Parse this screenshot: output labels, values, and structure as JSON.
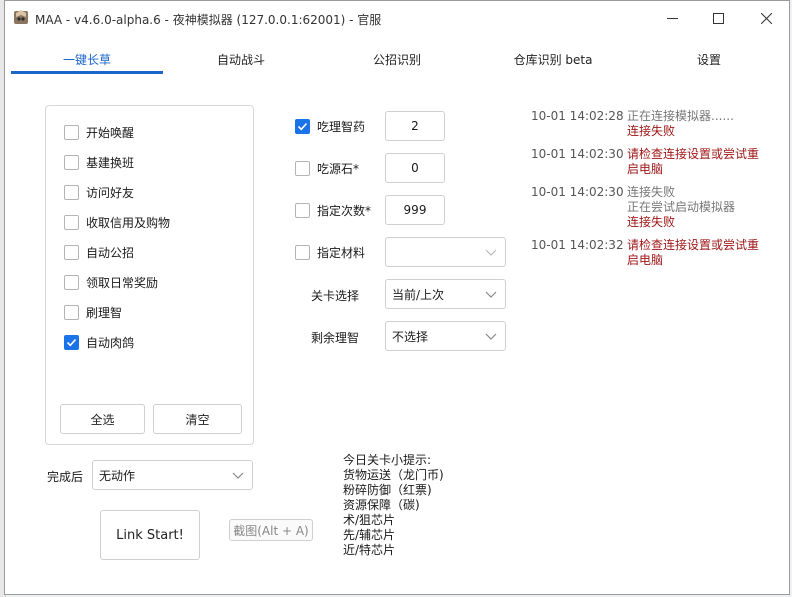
{
  "window": {
    "title": "MAA - v4.6.0-alpha.6 - 夜神模拟器 (127.0.0.1:62001) - 官服"
  },
  "tabs": [
    {
      "label": "一键长草",
      "active": true
    },
    {
      "label": "自动战斗",
      "active": false
    },
    {
      "label": "公招识别",
      "active": false
    },
    {
      "label": "仓库识别 beta",
      "active": false
    },
    {
      "label": "设置",
      "active": false
    }
  ],
  "tasks": [
    {
      "label": "开始唤醒",
      "checked": false
    },
    {
      "label": "基建换班",
      "checked": false
    },
    {
      "label": "访问好友",
      "checked": false
    },
    {
      "label": "收取信用及购物",
      "checked": false
    },
    {
      "label": "自动公招",
      "checked": false
    },
    {
      "label": "领取日常奖励",
      "checked": false
    },
    {
      "label": "刷理智",
      "checked": false
    },
    {
      "label": "自动肉鸽",
      "checked": true
    }
  ],
  "task_buttons": {
    "select_all": "全选",
    "clear": "清空"
  },
  "completion": {
    "label": "完成后",
    "value": "无动作"
  },
  "start_button": "Link Start!",
  "screenshot_button": "截图(Alt + A)",
  "options": {
    "medicine": {
      "label": "吃理智药",
      "checked": true,
      "value": "2"
    },
    "stone": {
      "label": "吃源石*",
      "checked": false,
      "value": "0"
    },
    "times": {
      "label": "指定次数*",
      "checked": false,
      "value": "999"
    },
    "material": {
      "label": "指定材料",
      "checked": false,
      "value": ""
    },
    "stage": {
      "label": "关卡选择",
      "value": "当前/上次"
    },
    "remaining": {
      "label": "剩余理智",
      "value": "不选择"
    }
  },
  "log": [
    {
      "time": "10-01  14:02:28",
      "messages": [
        {
          "text": "正在连接模拟器......",
          "color": "grey"
        },
        {
          "text": "连接失败",
          "color": "red"
        }
      ]
    },
    {
      "time": "10-01  14:02:30",
      "messages": [
        {
          "text": "请检查连接设置或尝试重",
          "color": "red"
        },
        {
          "text": "启电脑",
          "color": "red"
        }
      ]
    },
    {
      "time": "10-01  14:02:30",
      "messages": [
        {
          "text": "连接失败",
          "color": "grey"
        },
        {
          "text": "正在尝试启动模拟器",
          "color": "grey"
        },
        {
          "text": "连接失败",
          "color": "red"
        }
      ]
    },
    {
      "time": "10-01  14:02:32",
      "messages": [
        {
          "text": "请检查连接设置或尝试重",
          "color": "red"
        },
        {
          "text": "启电脑",
          "color": "red"
        }
      ]
    }
  ],
  "tips": [
    "今日关卡小提示:",
    "货物运送（龙门币)",
    "粉碎防御（红票)",
    "资源保障（碳)",
    "术/狙芯片",
    "先/辅芯片",
    "近/特芯片"
  ],
  "colors": {
    "accent": "#1a66c9",
    "error": "#a01818",
    "info": "#777777"
  }
}
